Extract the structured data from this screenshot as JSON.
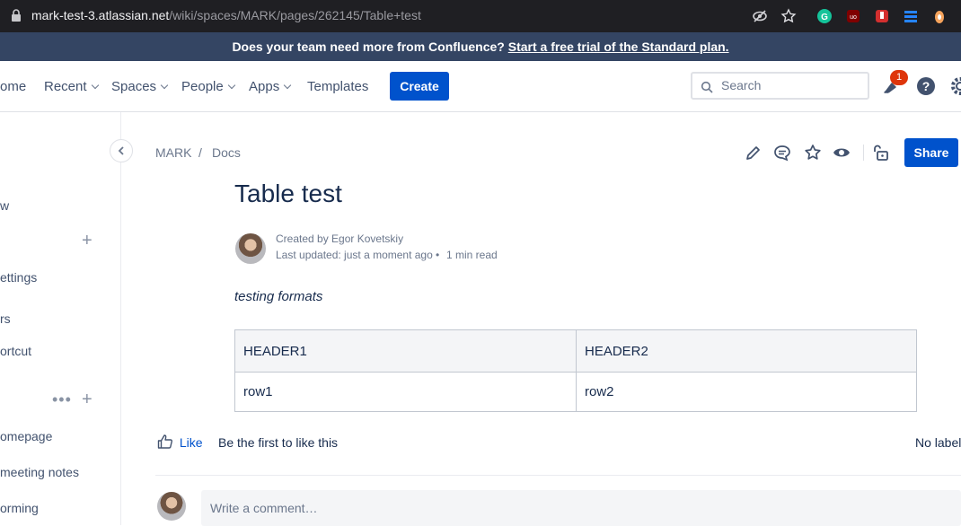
{
  "browser": {
    "url_host": "mark-test-3.atlassian.net",
    "url_path": "/wiki/spaces/MARK/pages/262145/Table+test"
  },
  "banner": {
    "text": "Does your team need more from Confluence?",
    "link": "Start a free trial of the Standard plan."
  },
  "nav": {
    "home": "ome",
    "recent": "Recent",
    "spaces": "Spaces",
    "people": "People",
    "apps": "Apps",
    "templates": "Templates",
    "create": "Create",
    "search_placeholder": "Search",
    "notifications_count": "1"
  },
  "sidebar": {
    "items": [
      "w",
      "ettings",
      "rs",
      "ortcut",
      "omepage",
      "meeting notes",
      "orming"
    ]
  },
  "breadcrumb": {
    "space": "MARK",
    "sep": "/",
    "page": "Docs"
  },
  "page": {
    "title": "Table test",
    "created_by": "Created by Egor Kovetskiy",
    "last_updated": "Last updated: just a moment ago",
    "read_time": "1 min read",
    "intro": "testing formats",
    "table": {
      "headers": [
        "HEADER1",
        "HEADER2"
      ],
      "rows": [
        [
          "row1",
          "row2"
        ]
      ]
    }
  },
  "actions": {
    "share": "Share",
    "like": "Like",
    "like_prompt": "Be the first to like this",
    "labels": "No label",
    "comment_placeholder": "Write a comment…"
  },
  "colors": {
    "primary": "#0052cc",
    "banner": "#344563",
    "text": "#172b4d",
    "badge": "#de350b"
  }
}
